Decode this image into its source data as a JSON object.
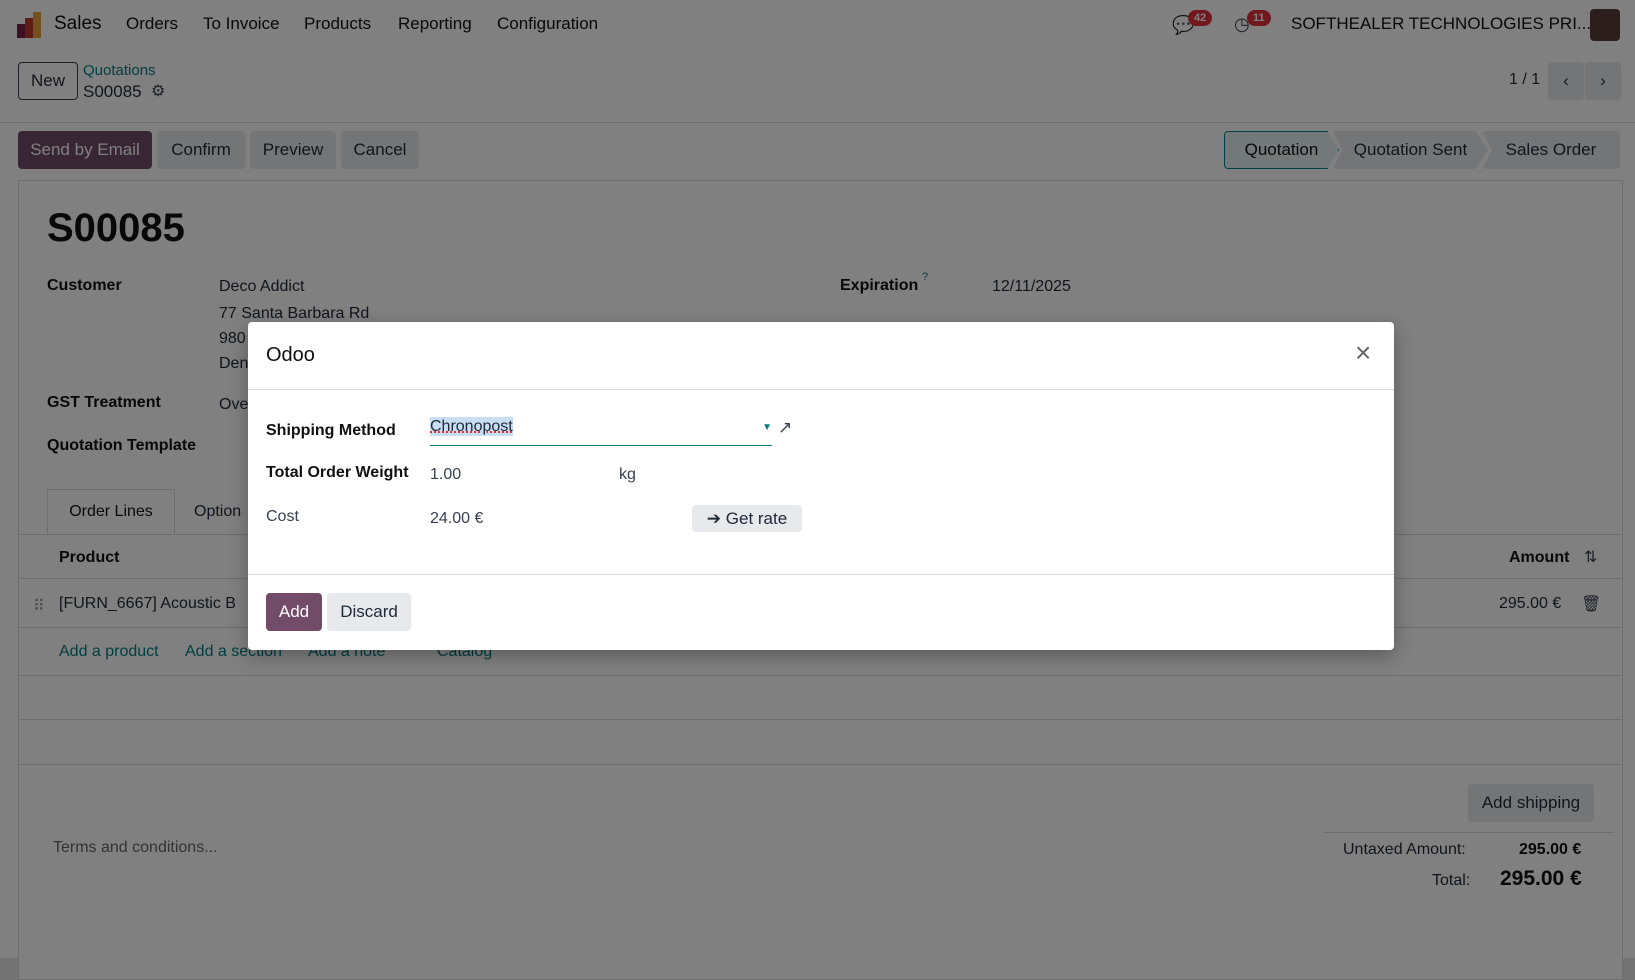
{
  "nav": {
    "app": "Sales",
    "menu": [
      "Orders",
      "To Invoice",
      "Products",
      "Reporting",
      "Configuration"
    ],
    "messages_count": "42",
    "activities_count": "11",
    "company": "SOFTHEALER TECHNOLOGIES PRI..."
  },
  "control": {
    "new_label": "New",
    "breadcrumb": "Quotations",
    "record": "S00085",
    "pager": "1 / 1"
  },
  "actions": {
    "send": "Send by Email",
    "confirm": "Confirm",
    "preview": "Preview",
    "cancel": "Cancel"
  },
  "status": {
    "steps": [
      "Quotation",
      "Quotation Sent",
      "Sales Order"
    ],
    "active": "Quotation"
  },
  "form": {
    "title": "S00085",
    "customer_label": "Customer",
    "customer_name": "Deco Addict",
    "addr1": "77 Santa Barbara Rd",
    "addr2": "980",
    "addr3": "Den",
    "gst_label": "GST Treatment",
    "gst_value": "Ove",
    "template_label": "Quotation Template",
    "expiration_label": "Expiration",
    "help": "?",
    "expiration": "12/11/2025",
    "tabs": [
      "Order Lines",
      "Option"
    ],
    "col_product": "Product",
    "col_amount": "Amount",
    "line_product": "[FURN_6667] Acoustic B",
    "line_amount": "295.00 €",
    "add_links": [
      "Add a product",
      "Add a section",
      "Add a note",
      "Catalog"
    ],
    "add_shipping": "Add shipping",
    "terms_placeholder": "Terms and conditions...",
    "untaxed_label": "Untaxed Amount:",
    "untaxed": "295.00 €",
    "total_label": "Total:",
    "total": "295.00 €"
  },
  "dialog": {
    "title": "Odoo",
    "shipping_label": "Shipping Method",
    "shipping_value": "Chronopost",
    "weight_label": "Total Order Weight",
    "weight": "1.00",
    "unit": "kg",
    "cost_label": "Cost",
    "cost": "24.00 €",
    "get_rate": "Get rate",
    "add": "Add",
    "discard": "Discard"
  }
}
